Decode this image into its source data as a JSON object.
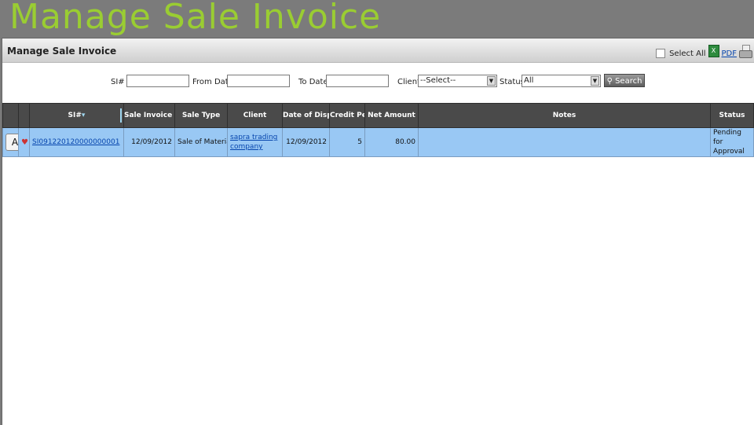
{
  "slide_title": "Manage Sale Invoice",
  "panel": {
    "title": "Manage Sale Invoice",
    "select_all_label": "Select All",
    "pdf_label": "PDF",
    "xls_icon": "excel-icon",
    "print_icon": "printer-icon"
  },
  "filters": {
    "si_label": "SI#",
    "si_value": "",
    "from_date_label": "From Date",
    "from_date_value": "",
    "to_date_label": "To Date",
    "to_date_value": "",
    "client_label": "Client",
    "client_selected": "--Select--",
    "status_label": "Status",
    "status_selected": "All",
    "search_label": "Search"
  },
  "table": {
    "headers": [
      "SI#",
      "Sale Invoice Date",
      "Sale Type",
      "Client",
      "Date of Dispatch",
      "Credit Period",
      "Net Amount",
      "Notes",
      "Status"
    ],
    "rows": [
      {
        "action": "A",
        "si": "SI091220120000000001",
        "invoice_date": "12/09/2012",
        "sale_type": "Sale of Material",
        "client": "sapra trading company",
        "dispatch_date": "12/09/2012",
        "credit_period": "5",
        "net_amount": "80.00",
        "notes": "",
        "status": "Pending for Approval"
      }
    ]
  }
}
